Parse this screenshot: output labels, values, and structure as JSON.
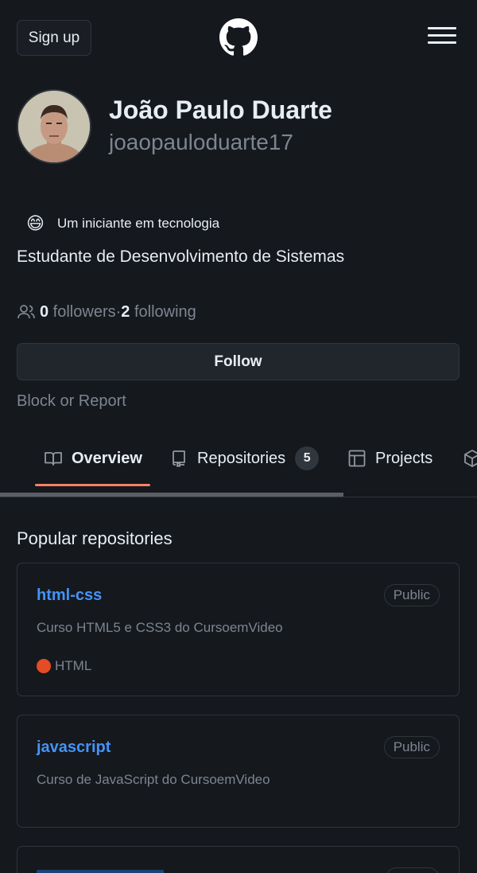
{
  "header": {
    "signup_label": "Sign up",
    "logo_icon": "github-mark-icon",
    "menu_icon": "hamburger-menu-icon"
  },
  "profile": {
    "name": "João Paulo Duarte",
    "login": "joaopauloduarte17",
    "status_emoji": "😄",
    "status_text": "Um iniciante em tecnologia",
    "bio": "Estudante de Desenvolvimento de Sistemas",
    "followers_count": "0",
    "followers_label": " followers",
    "separator": " · ",
    "following_count": "2",
    "following_label": " following",
    "follow_button": "Follow",
    "block_report": "Block or Report"
  },
  "tabs": [
    {
      "label": "Overview",
      "icon": "book-icon",
      "active": true
    },
    {
      "label": "Repositories",
      "icon": "repo-icon",
      "count": "5"
    },
    {
      "label": "Projects",
      "icon": "table-icon"
    },
    {
      "label": "",
      "icon": "package-icon"
    }
  ],
  "popular": {
    "title": "Popular repositories",
    "repos": [
      {
        "name": "html-css",
        "visibility": "Public",
        "description": "Curso HTML5 e CSS3 do CursoemVideo",
        "language": "HTML",
        "language_color": "#e34c26"
      },
      {
        "name": "javascript",
        "visibility": "Public",
        "description": "Curso de JavaScript do CursoemVideo"
      }
    ]
  },
  "colors": {
    "link": "#4493f8",
    "tab_underline": "#f78166",
    "muted": "#7d8590"
  }
}
